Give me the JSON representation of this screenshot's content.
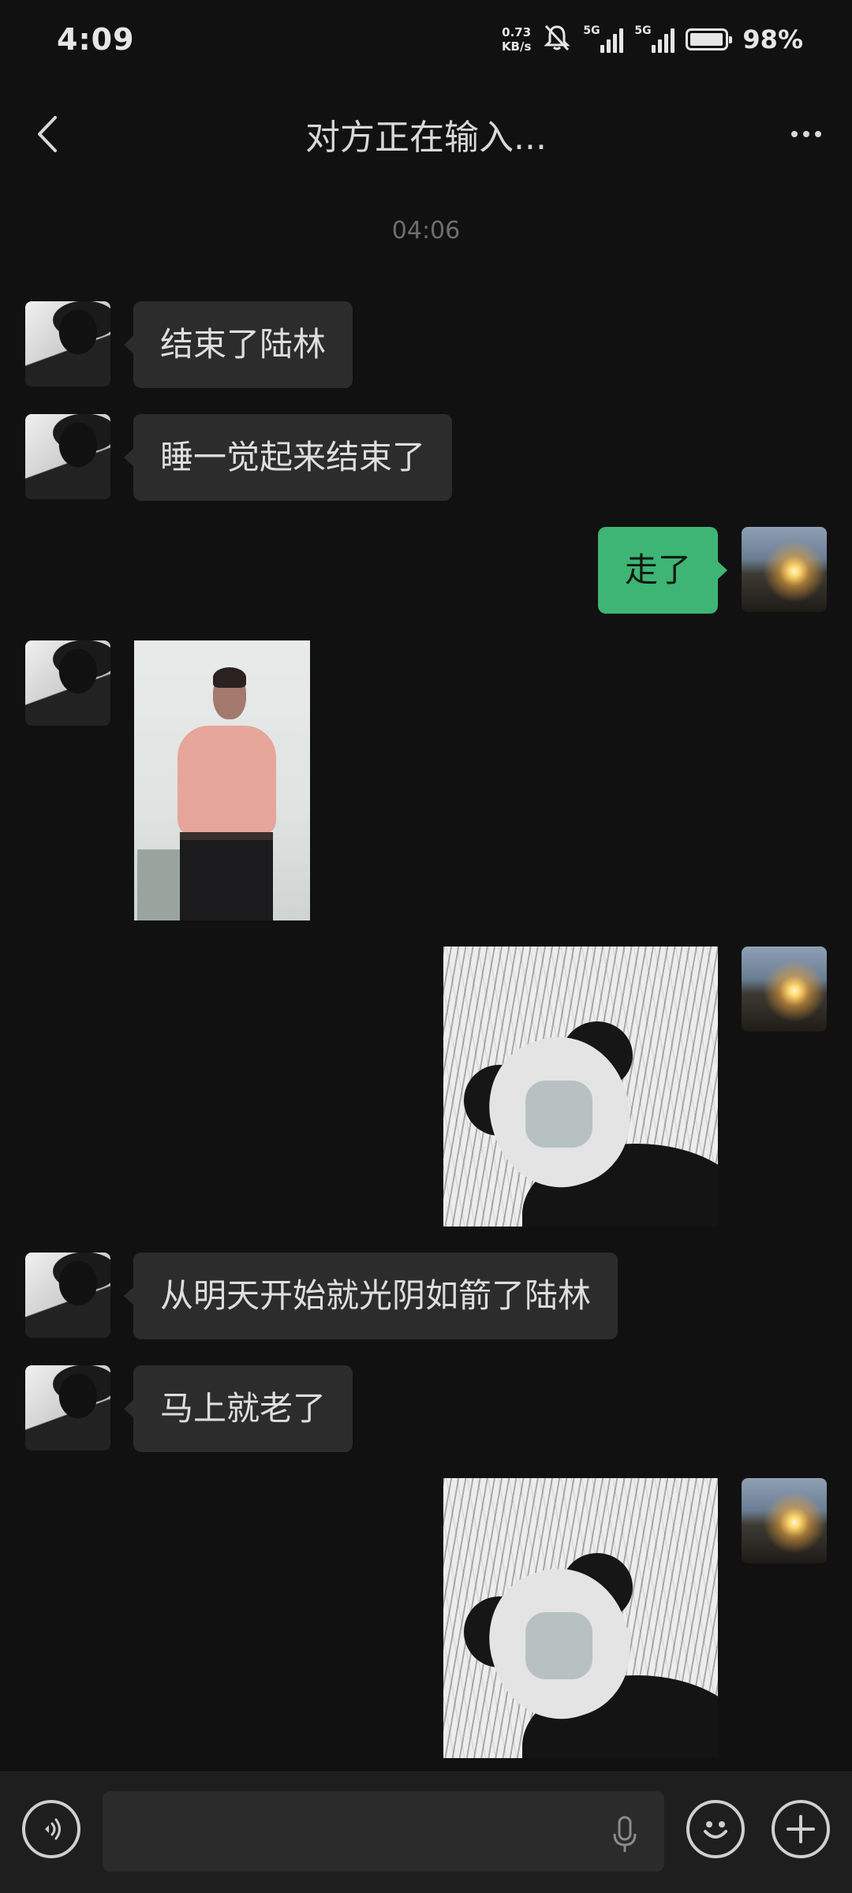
{
  "status_bar": {
    "time": "4:09",
    "net_speed_value": "0.73",
    "net_speed_unit": "KB/s",
    "signal1_label": "5G",
    "signal2_label": "5G",
    "battery_percent": "98%"
  },
  "header": {
    "title": "对方正在输入..."
  },
  "chat": {
    "timestamp": "04:06",
    "messages": [
      {
        "side": "left",
        "type": "text",
        "text": "结束了陆林"
      },
      {
        "side": "left",
        "type": "text",
        "text": "睡一觉起来结束了"
      },
      {
        "side": "right",
        "type": "text",
        "text": "走了"
      },
      {
        "side": "left",
        "type": "image",
        "content": "photo"
      },
      {
        "side": "right",
        "type": "image",
        "content": "panda-sticker"
      },
      {
        "side": "left",
        "type": "text",
        "text": "从明天开始就光阴如箭了陆林"
      },
      {
        "side": "left",
        "type": "text",
        "text": "马上就老了"
      },
      {
        "side": "right",
        "type": "image",
        "content": "panda-sticker"
      }
    ]
  },
  "input_bar": {
    "input_value": "",
    "icons": [
      "voice-icon",
      "mic-icon",
      "emoji-icon",
      "plus-icon"
    ]
  },
  "colors": {
    "background": "#111111",
    "incoming_bubble": "#2c2c2c",
    "outgoing_bubble": "#3eb575",
    "bottom_bar": "#1e1e1e"
  }
}
